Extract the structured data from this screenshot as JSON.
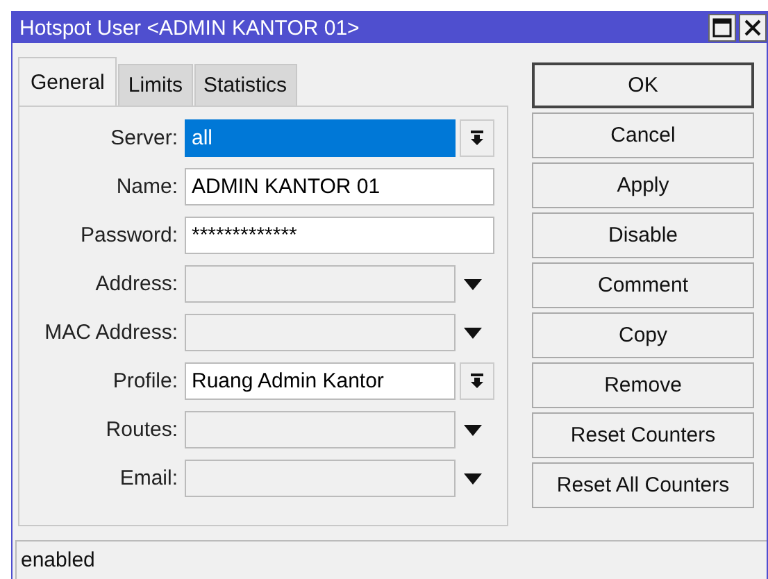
{
  "window": {
    "title": "Hotspot User <ADMIN KANTOR 01>"
  },
  "tabs": [
    {
      "label": "General",
      "selected": true
    },
    {
      "label": "Limits",
      "selected": false
    },
    {
      "label": "Statistics",
      "selected": false
    }
  ],
  "fields": [
    {
      "label": "Server:",
      "kind": "combo",
      "value": "all",
      "highlighted": true
    },
    {
      "label": "Name:",
      "kind": "text",
      "value": "ADMIN KANTOR 01",
      "highlighted": false
    },
    {
      "label": "Password:",
      "kind": "text",
      "value": "*************",
      "highlighted": false
    },
    {
      "label": "Address:",
      "kind": "optional",
      "highlighted": false
    },
    {
      "label": "MAC Address:",
      "kind": "optional",
      "highlighted": false
    },
    {
      "label": "Profile:",
      "kind": "combo",
      "value": "Ruang Admin Kantor",
      "highlighted": false
    },
    {
      "label": "Routes:",
      "kind": "optional",
      "highlighted": false
    },
    {
      "label": "Email:",
      "kind": "optional",
      "highlighted": false
    }
  ],
  "buttons": [
    "OK",
    "Cancel",
    "Apply",
    "Disable",
    "Comment",
    "Copy",
    "Remove",
    "Reset Counters",
    "Reset All Counters"
  ],
  "status_bar": "enabled"
}
